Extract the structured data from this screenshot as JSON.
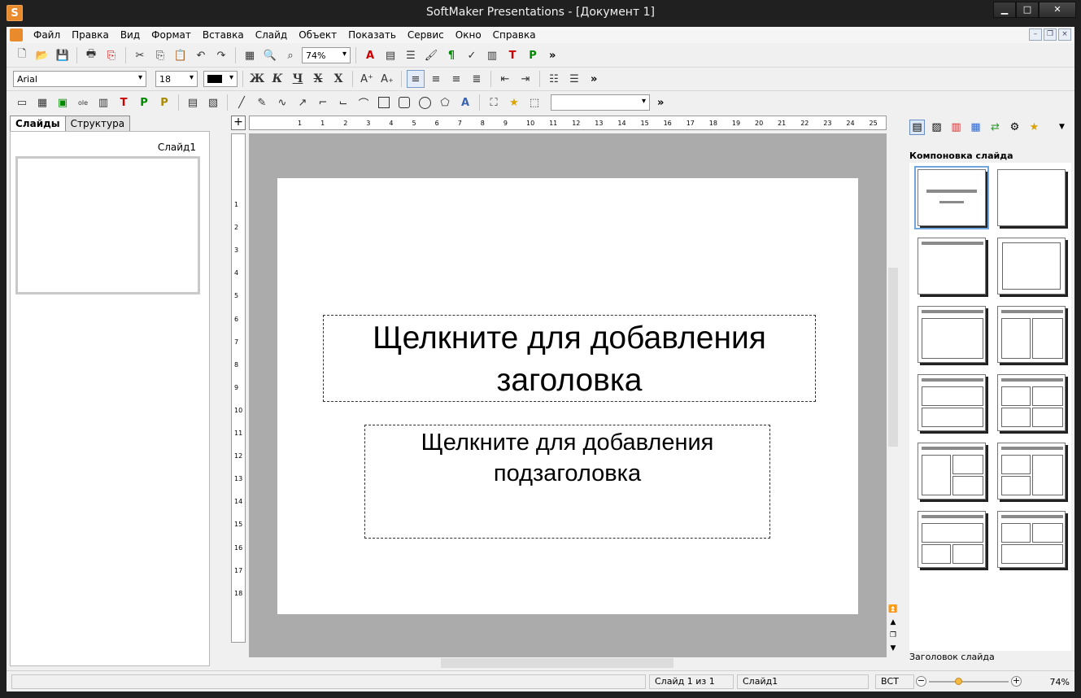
{
  "window": {
    "title": "SoftMaker Presentations - [Документ 1]",
    "app_icon": "S",
    "buttons": {
      "minimize": "▁",
      "maximize": "□",
      "close": "✕"
    }
  },
  "menu": {
    "items": [
      "Файл",
      "Правка",
      "Вид",
      "Формат",
      "Вставка",
      "Слайд",
      "Объект",
      "Показать",
      "Сервис",
      "Окно",
      "Справка"
    ],
    "mdi": {
      "minimize": "–",
      "restore": "❐",
      "close": "×"
    }
  },
  "toolbar": {
    "zoom_value": "74%",
    "font_name": "Arial",
    "font_size": "18",
    "bold": "Ж",
    "italic": "К",
    "underline": "Ч",
    "strike": "Х",
    "double_strike": "Х",
    "more": "»",
    "color_accent": "#000000"
  },
  "left_panel": {
    "tabs": [
      "Слайды",
      "Структура"
    ],
    "slide_label": "Слайд1"
  },
  "ruler": {
    "h_labels": [
      "1",
      "1",
      "2",
      "3",
      "4",
      "5",
      "6",
      "7",
      "8",
      "9",
      "10",
      "11",
      "12",
      "13",
      "14",
      "15",
      "16",
      "17",
      "18",
      "19",
      "20",
      "21",
      "22",
      "23",
      "24",
      "25"
    ],
    "v_labels": [
      "1",
      "2",
      "3",
      "4",
      "5",
      "6",
      "7",
      "8",
      "9",
      "10",
      "11",
      "12",
      "13",
      "14",
      "15",
      "16",
      "17",
      "18"
    ],
    "corner": "+"
  },
  "slide": {
    "title_placeholder_line1": "Щелкните для добавления",
    "title_placeholder_line2": "заголовка",
    "subtitle_placeholder_line1": "Щелкните для добавления",
    "subtitle_placeholder_line2": "подзаголовка"
  },
  "right_panel": {
    "heading": "Компоновка слайда",
    "status": "Заголовок слайда"
  },
  "statusbar": {
    "slide_count": "Слайд 1 из 1",
    "slide_name": "Слайд1",
    "insert_mode": "ВСТ",
    "zoom": "74%",
    "zoom_fraction": 0.37
  }
}
